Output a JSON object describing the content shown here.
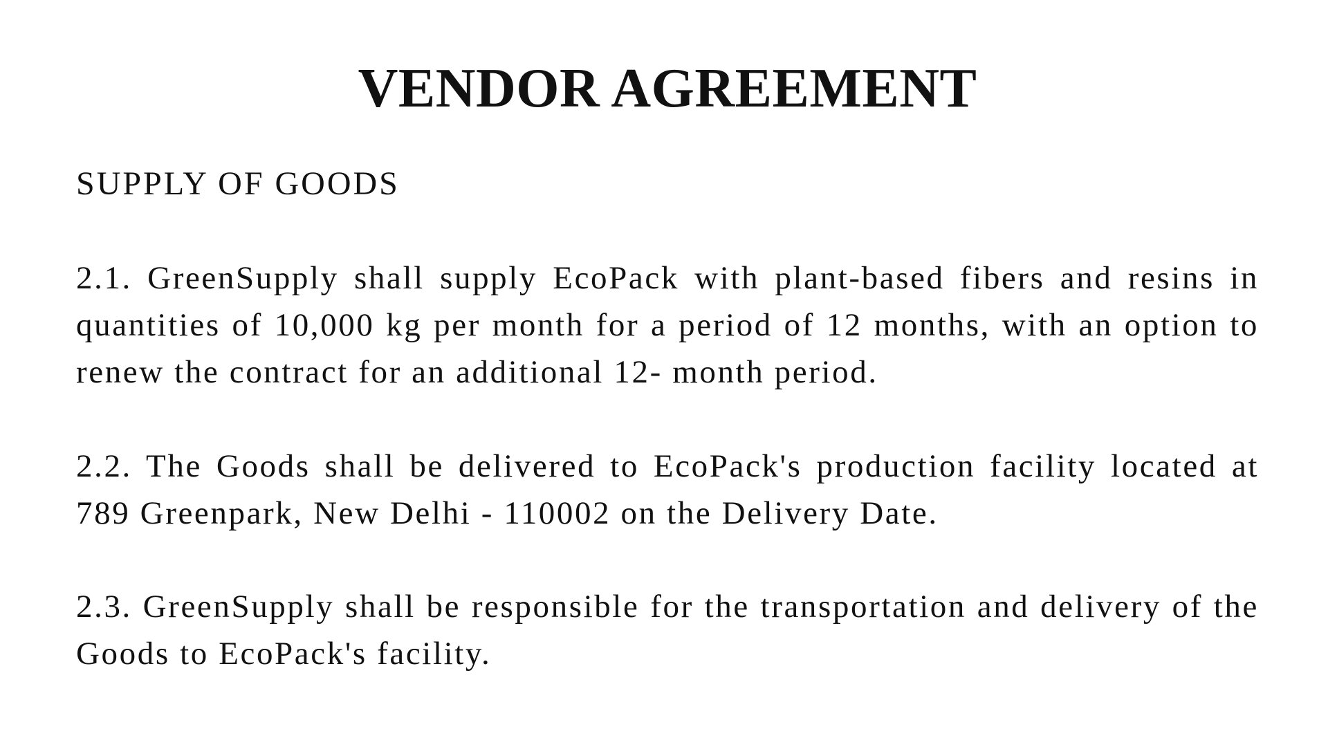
{
  "document": {
    "title": "VENDOR AGREEMENT",
    "section_heading": "SUPPLY OF GOODS",
    "clauses": [
      {
        "text": "2.1. GreenSupply shall supply EcoPack with plant-based fibers and resins in quantities of 10,000 kg per month for a period of 12 months, with an option to renew the contract for an additional 12- month period."
      },
      {
        "text": "2.2. The Goods shall be delivered to EcoPack's production facility located at 789 Greenpark, New Delhi - 110002 on the Delivery Date."
      },
      {
        "text": "2.3. GreenSupply shall be responsible for the transportation and delivery of the Goods to EcoPack's facility."
      }
    ]
  }
}
